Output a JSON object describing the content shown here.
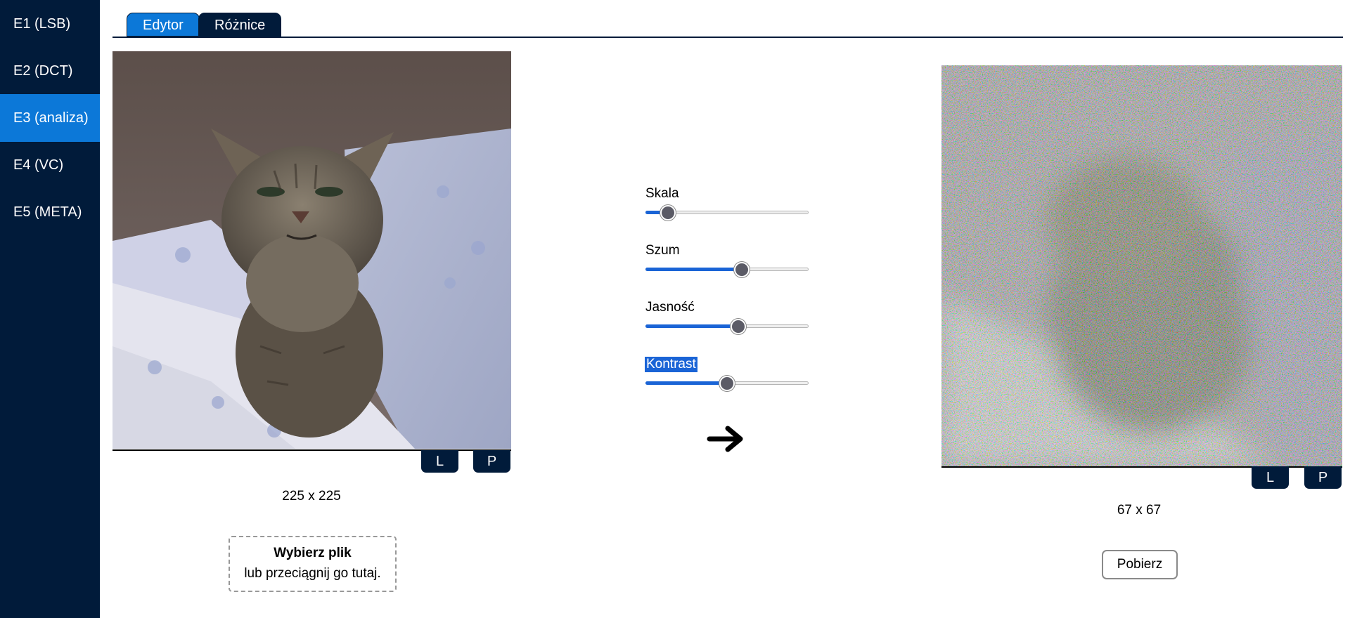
{
  "sidebar": {
    "items": [
      {
        "label": "E1 (LSB)"
      },
      {
        "label": "E2 (DCT)"
      },
      {
        "label": "E3 (analiza)"
      },
      {
        "label": "E4 (VC)"
      },
      {
        "label": "E5 (META)"
      }
    ]
  },
  "tabs": [
    {
      "label": "Edytor"
    },
    {
      "label": "Różnice"
    }
  ],
  "source": {
    "left_label": "L",
    "right_label": "P",
    "dimensions": "225 x 225",
    "upload_title": "Wybierz plik",
    "upload_hint": "lub przeciągnij go tutaj."
  },
  "controls": [
    {
      "label": "Skala",
      "value_fraction": 0.14
    },
    {
      "label": "Szum",
      "value_fraction": 0.59
    },
    {
      "label": "Jasność",
      "value_fraction": 0.57
    },
    {
      "label": "Kontrast",
      "value_fraction": 0.5
    }
  ],
  "result": {
    "left_label": "L",
    "right_label": "P",
    "dimensions": "67 x 67",
    "download_label": "Pobierz"
  },
  "colors": {
    "sidebar": "#011b3a",
    "accent": "#0c78d8",
    "slider_fill": "#1a64d6"
  }
}
